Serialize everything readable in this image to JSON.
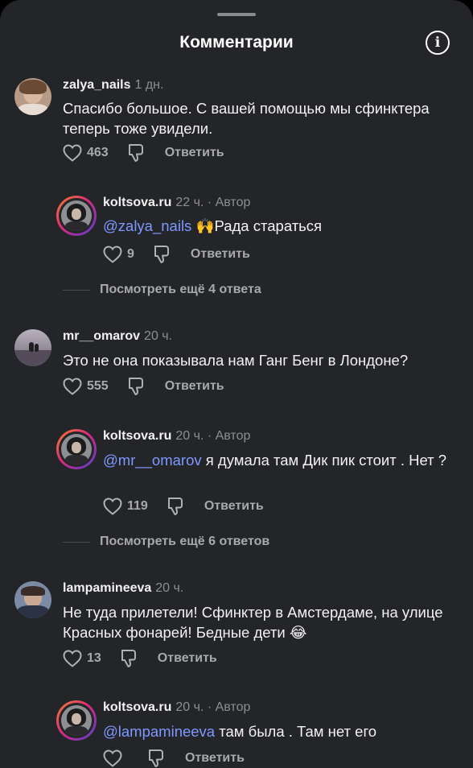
{
  "header": {
    "title": "Комментарии",
    "info_icon": "info-circle-icon"
  },
  "comments": [
    {
      "username": "zalya_nails",
      "time": "1 дн.",
      "text": "Спасибо большое. С вашей помощью мы сфинктера теперь тоже увидели.",
      "likes": "463",
      "reply_label": "Ответить",
      "reply": {
        "username": "koltsova.ru",
        "meta": "22 ч. · Автор",
        "mention": "@zalya_nails",
        "text": "🙌Рада стараться",
        "likes": "9",
        "reply_label": "Ответить"
      },
      "more_label": "Посмотреть ещё 4 ответа"
    },
    {
      "username": "mr__omarov",
      "time": "20 ч.",
      "text": "Это не она показывала нам Ганг Бенг в Лондоне?",
      "likes": "555",
      "reply_label": "Ответить",
      "reply": {
        "username": "koltsova.ru",
        "meta": "20 ч. · Автор",
        "mention": "@mr__omarov",
        "text": "я думала там Дик пик стоит . Нет ?",
        "likes": "119",
        "reply_label": "Ответить"
      },
      "more_label": "Посмотреть ещё 6 ответов"
    },
    {
      "username": "lampamineeva",
      "time": "20 ч.",
      "text": "Не туда прилетели! Сфинктер в Амстердаме, на улице Красных фонарей! Бедные дети 😂",
      "likes": "13",
      "reply_label": "Ответить",
      "reply": {
        "username": "koltsova.ru",
        "meta": "20 ч. · Автор",
        "mention": "@lampamineeva",
        "text": "там была . Там нет его",
        "likes": "",
        "reply_label": "Ответить"
      }
    }
  ],
  "colors": {
    "background": "#242529",
    "mention": "#7f98ff",
    "muted": "#8d8e93"
  }
}
